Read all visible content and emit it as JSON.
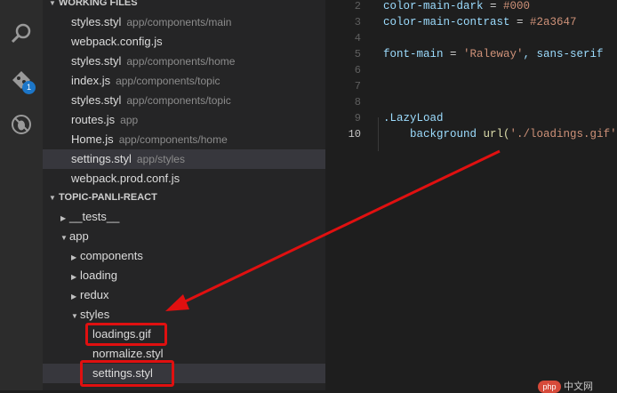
{
  "activity_bar": {
    "badge_count": "1",
    "icons": [
      "search-icon",
      "git-icon",
      "debug-icon"
    ]
  },
  "working_files": {
    "header": "WORKING FILES",
    "items": [
      {
        "name": "styles.styl",
        "path": "app/components/main"
      },
      {
        "name": "webpack.config.js",
        "path": ""
      },
      {
        "name": "styles.styl",
        "path": "app/components/home"
      },
      {
        "name": "index.js",
        "path": "app/components/topic"
      },
      {
        "name": "styles.styl",
        "path": "app/components/topic"
      },
      {
        "name": "routes.js",
        "path": "app"
      },
      {
        "name": "Home.js",
        "path": "app/components/home"
      },
      {
        "name": "settings.styl",
        "path": "app/styles"
      },
      {
        "name": "webpack.prod.conf.js",
        "path": ""
      }
    ]
  },
  "explorer": {
    "header": "TOPIC-PANLI-REACT",
    "items": [
      {
        "label": "__tests__",
        "twisty": "▶"
      },
      {
        "label": "app",
        "twisty": "▼"
      },
      {
        "label": "components",
        "twisty": "▶"
      },
      {
        "label": "loading",
        "twisty": "▶"
      },
      {
        "label": "redux",
        "twisty": "▶"
      },
      {
        "label": "styles",
        "twisty": "▼"
      },
      {
        "label": "loadings.gif",
        "twisty": ""
      },
      {
        "label": "normalize.styl",
        "twisty": ""
      },
      {
        "label": "settings.styl",
        "twisty": ""
      }
    ]
  },
  "editor": {
    "line_numbers": [
      "2",
      "3",
      "4",
      "5",
      "6",
      "7",
      "8",
      "9",
      "10"
    ],
    "lines": [
      {
        "key": "color-main-dark",
        "op": " = ",
        "val": "#000"
      },
      {
        "key": "color-main-contrast",
        "op": " = ",
        "val": "#2a3647"
      },
      {
        "key": "",
        "op": "",
        "val": ""
      },
      {
        "key": "font-main",
        "op": " = ",
        "val": "'Raleway'",
        "rest": ", sans-serif"
      },
      {
        "key": "",
        "op": "",
        "val": ""
      },
      {
        "key": "",
        "op": "",
        "val": ""
      },
      {
        "key": "",
        "op": "",
        "val": ""
      },
      {
        "key": ".LazyLoad",
        "op": "",
        "val": ""
      },
      {
        "indent": "    ",
        "key": "background",
        "fn": " url(",
        "val": "'./loadings.gif'",
        "close": ")"
      }
    ]
  },
  "watermark": {
    "badge": "php",
    "text": "中文网"
  },
  "colors": {
    "annotation": "#e01010",
    "badge": "#1c76c8",
    "selection": "#37373d"
  }
}
